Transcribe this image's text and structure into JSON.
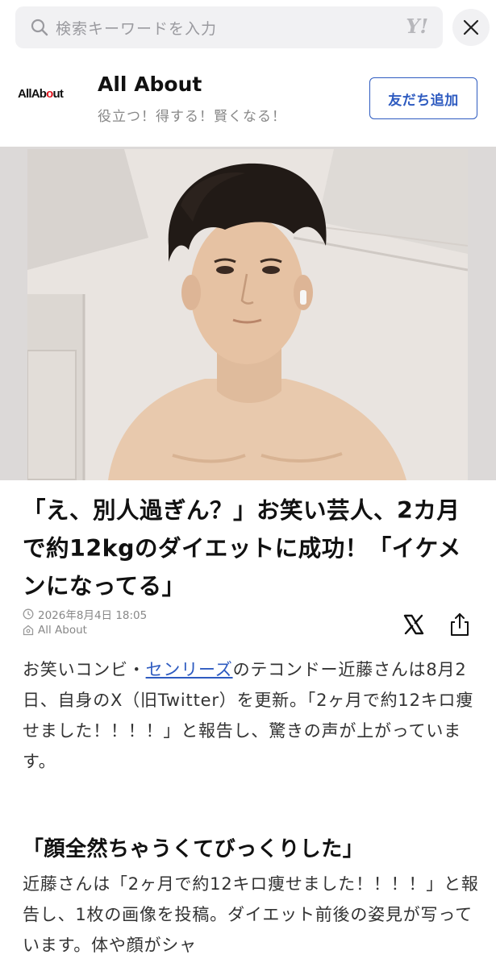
{
  "search": {
    "placeholder": "検索キーワードを入力",
    "brand_mark": "Y!"
  },
  "publisher": {
    "logo_text_a": "AllAb",
    "logo_text_o": "o",
    "logo_text_b": "ut",
    "name": "All About",
    "tagline": "役立つ！得する！賢くなる！",
    "follow_label": "友だち追加"
  },
  "article": {
    "headline": "「え、別人過ぎん？」お笑い芸人、2カ月で約12kgのダイエットに成功！「イケメンになってる」",
    "datetime": "2026年8月4日 18:05",
    "source": "All About",
    "body1_before_link": "お笑いコンビ・",
    "body1_link": "センリーズ",
    "body1_after_link": "のテコンドー近藤さんは8月2日、自身のX（旧Twitter）を更新。「2ヶ月で約12キロ痩せました！！！！」と報告し、驚きの声が上がっています。",
    "subheading": "「顔全然ちゃうくてびっくりした」",
    "body2": "近藤さんは「2ヶ月で約12キロ痩せました！！！！」と報告し、1枚の画像を投稿。ダイエット前後の姿見が写っています。体や顔がシャ"
  },
  "icons": {
    "search": "search-icon",
    "close": "close-icon",
    "clock": "clock-icon",
    "source": "source-icon",
    "x": "x-logo-icon",
    "share": "share-icon"
  },
  "colors": {
    "accent": "#2e5bc0",
    "logo_red": "#e0141e"
  }
}
